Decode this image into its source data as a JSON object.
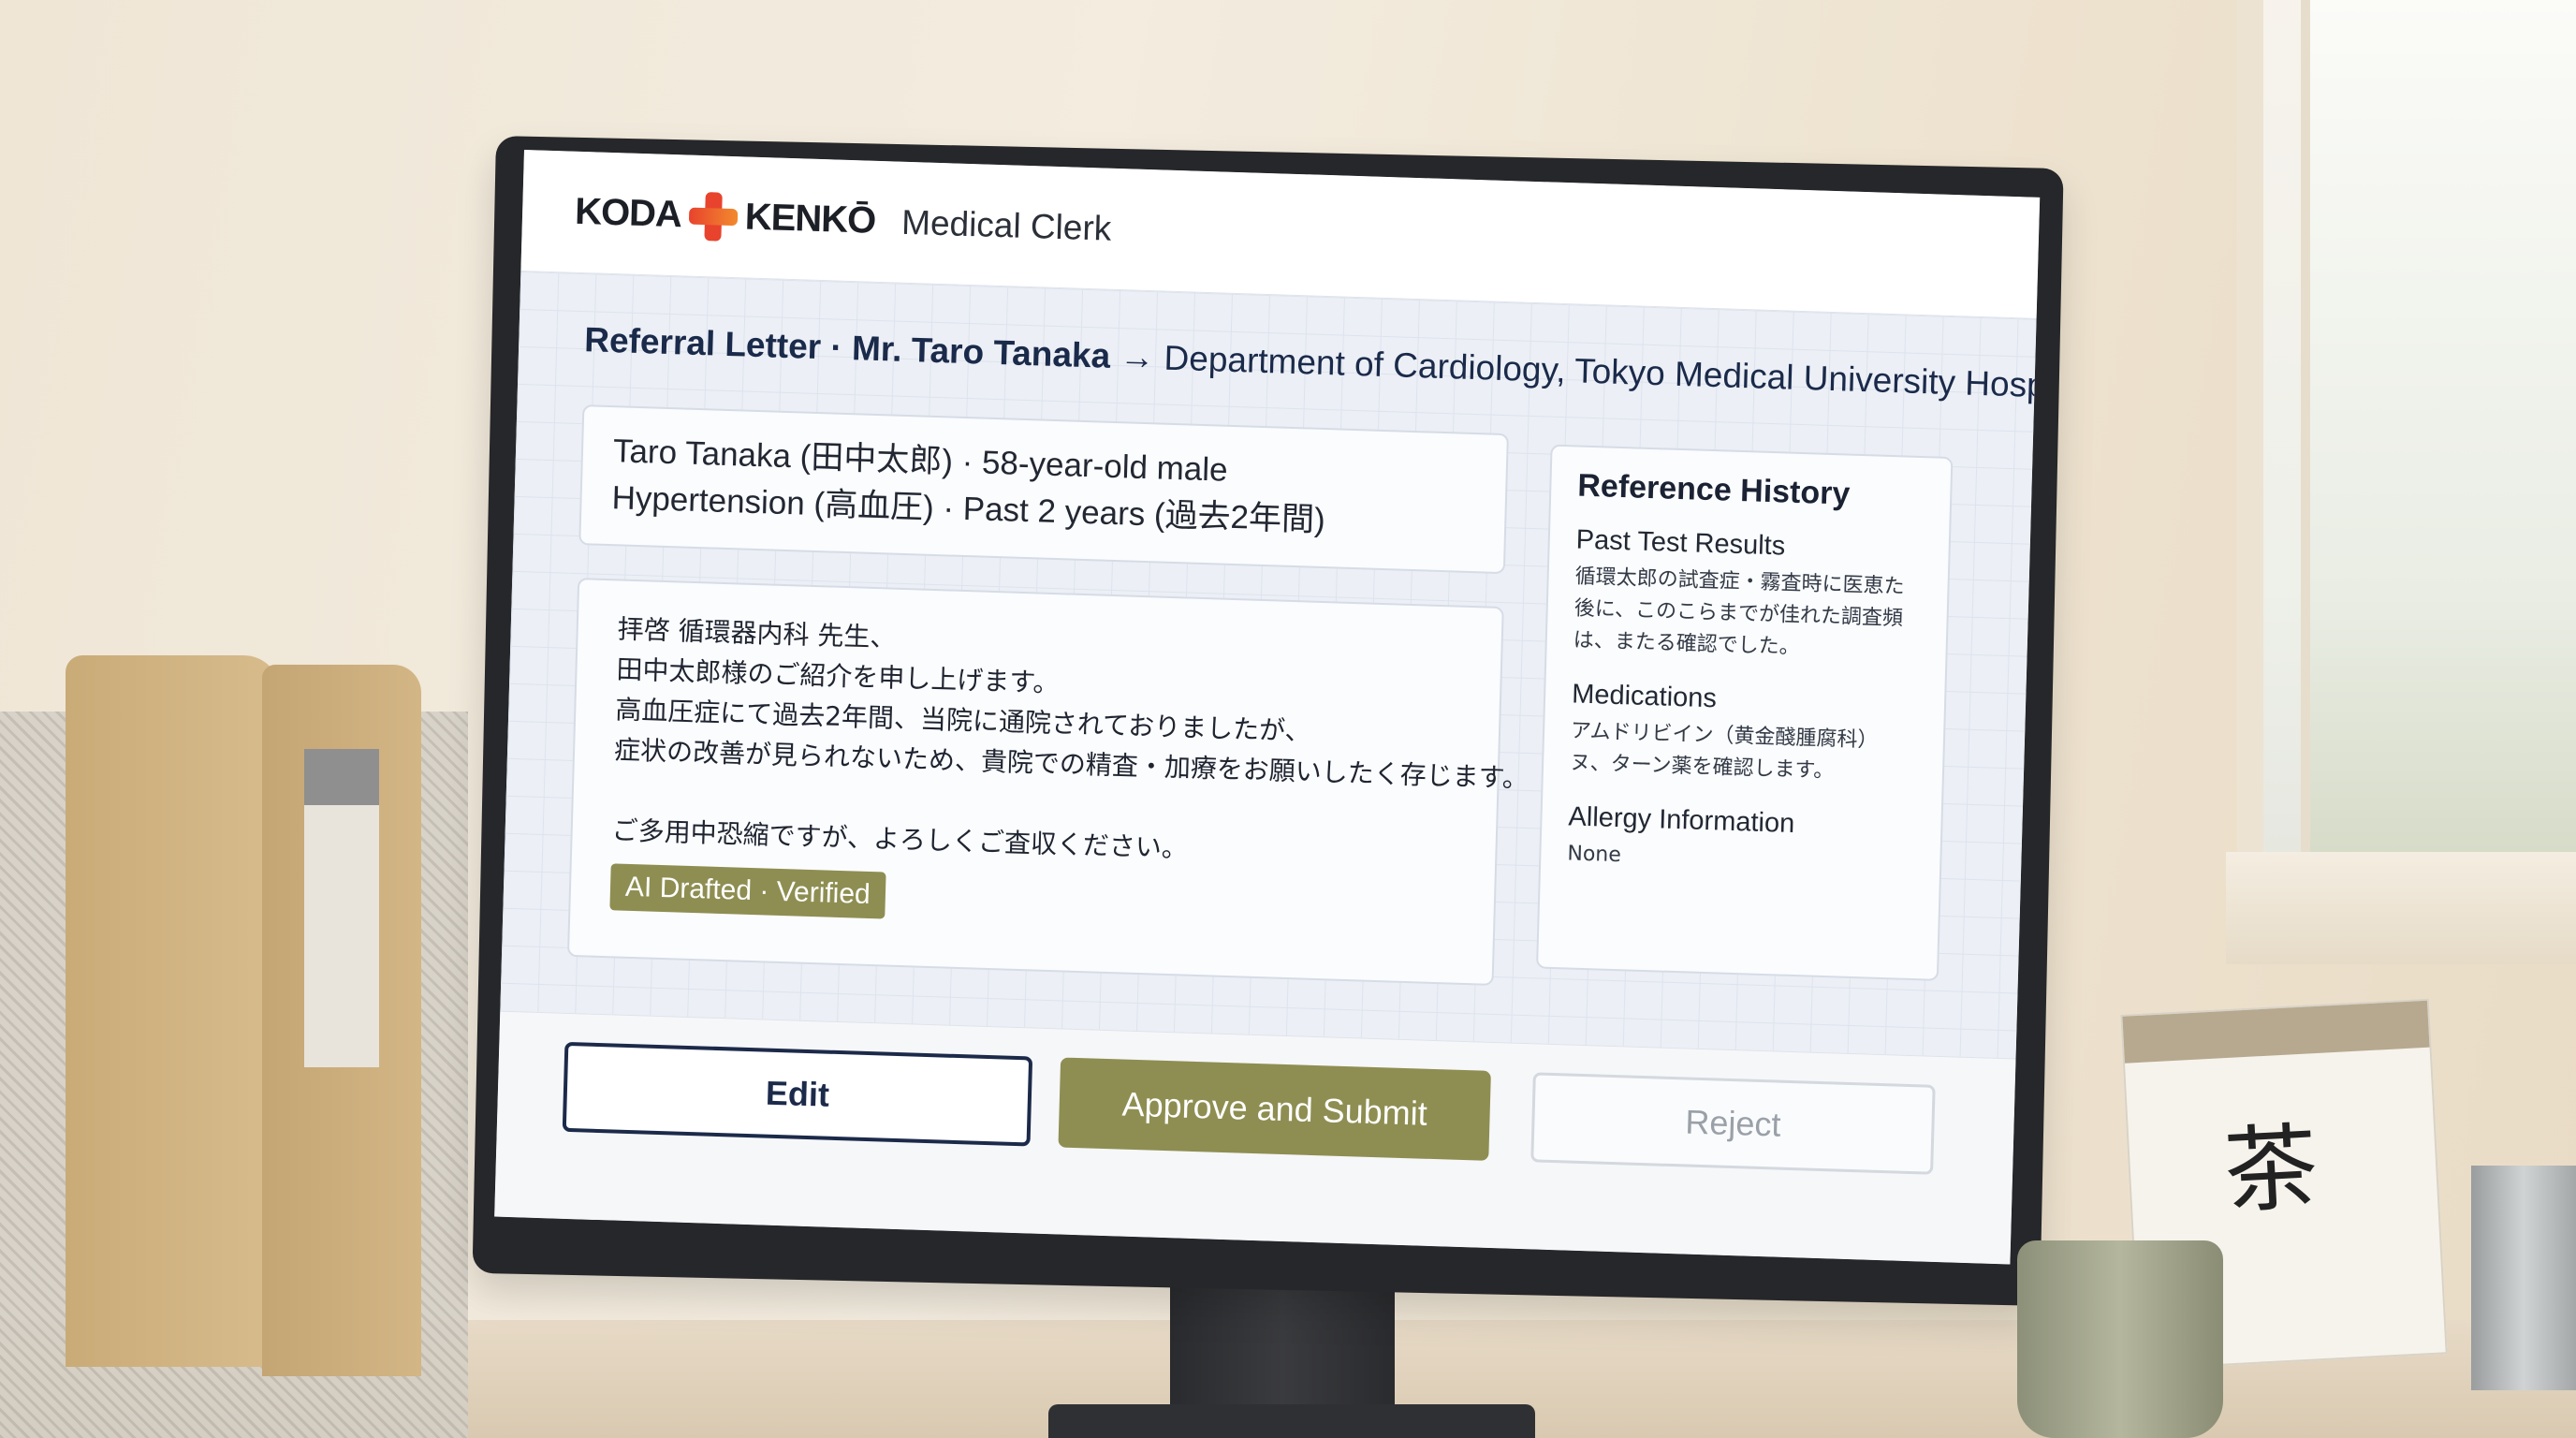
{
  "header": {
    "logo_left": "KODA",
    "logo_right": "KENKŌ",
    "app_name": "Medical Clerk"
  },
  "page_title": {
    "prefix": "Referral Letter · Mr. Taro Tanaka",
    "destination": "→ Department of Cardiology, Tokyo Medical University Hospital"
  },
  "patient": {
    "line1": "Taro Tanaka (田中太郎) · 58-year-old male",
    "line2": "Hypertension (高血圧) · Past 2 years (過去2年間)"
  },
  "letter": {
    "lines": [
      "拝啓 循環器内科 先生、",
      "田中太郎様のご紹介を申し上げます。",
      "高血圧症にて過去2年間、当院に通院されておりましたが、",
      "症状の改善が見られないため、貴院での精査・加療をお願いしたく存じます。"
    ],
    "closing": "ご多用中恐縮ですが、よろしくご査収ください。",
    "badge": "AI Drafted · Verified"
  },
  "reference": {
    "title": "Reference History",
    "sections": [
      {
        "heading": "Past Test Results",
        "body": "循環太郎の試査症・霧査時に医恵た後に、このこらまでが佳れた調査頻は、またる確認でした。"
      },
      {
        "heading": "Medications",
        "body": "アムドリビイン（黄金醆腫腐科）ヌ、ターン薬を確認します。"
      },
      {
        "heading": "Allergy Information",
        "body": "None"
      }
    ]
  },
  "actions": {
    "edit": "Edit",
    "approve": "Approve and Submit",
    "reject": "Reject"
  },
  "colors": {
    "accent_olive": "#8e8e52",
    "navy": "#1c2a4a",
    "logo_cross": "#e8432d"
  },
  "desk": {
    "calendar_kanji": "茶"
  }
}
